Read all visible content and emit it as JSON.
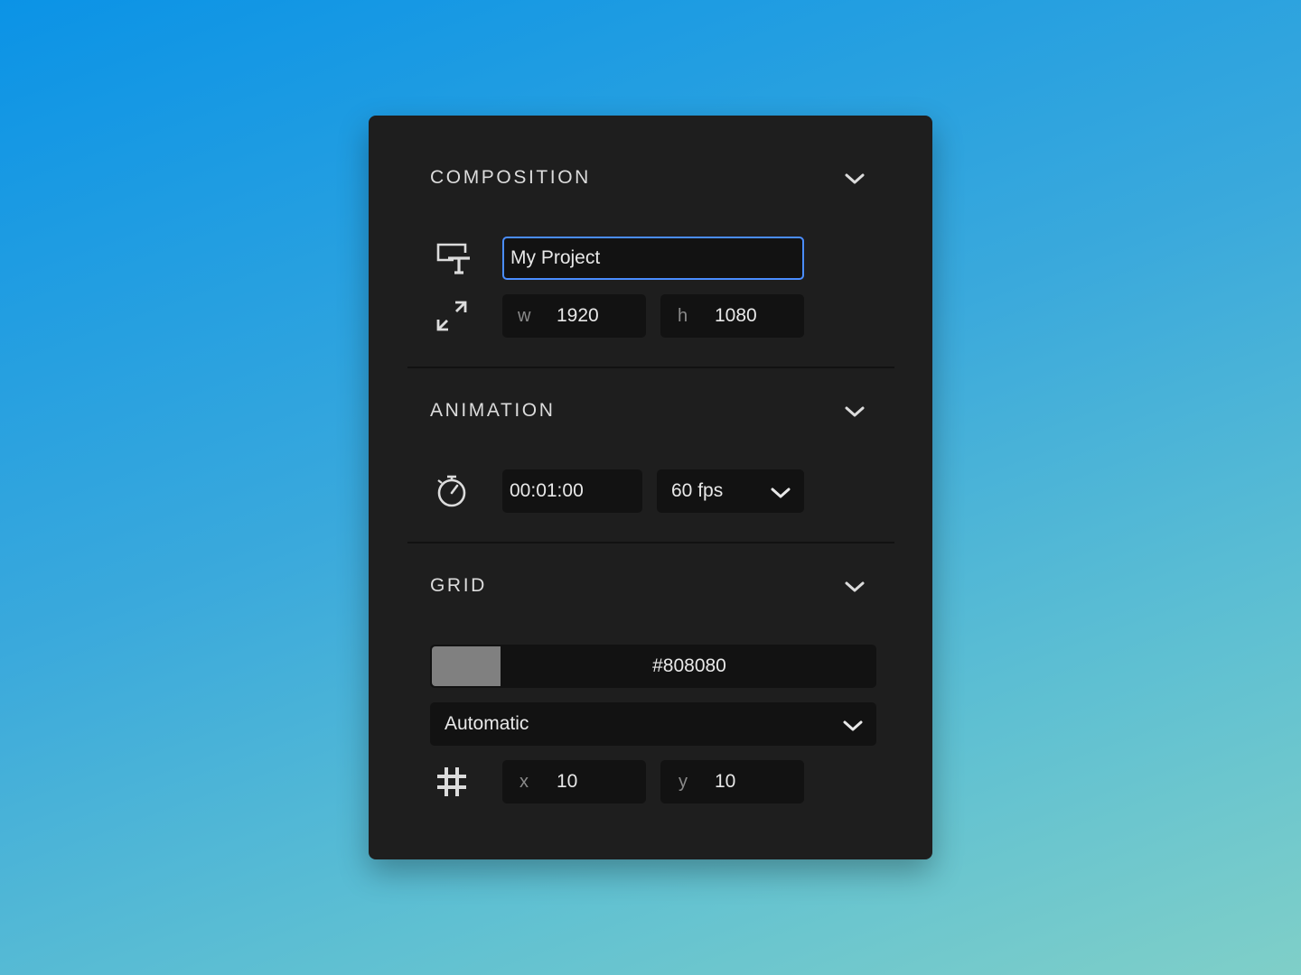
{
  "composition": {
    "title": "COMPOSITION",
    "project_name": "My Project",
    "width_label": "w",
    "width_value": "1920",
    "height_label": "h",
    "height_value": "1080"
  },
  "animation": {
    "title": "ANIMATION",
    "duration": "00:01:00",
    "frame_rate": "60 fps"
  },
  "grid": {
    "title": "GRID",
    "color_hex": "#808080",
    "mode": "Automatic",
    "x_label": "x",
    "x_value": "10",
    "y_label": "y",
    "y_value": "10"
  },
  "colors": {
    "panel_bg": "#1e1e1e",
    "field_bg": "#121212",
    "focus_border": "#4a8dff",
    "swatch": "#808080"
  },
  "icons": [
    "chevron-down-icon",
    "artboard-text-icon",
    "resize-arrows-icon",
    "stopwatch-icon",
    "hash-grid-icon"
  ]
}
